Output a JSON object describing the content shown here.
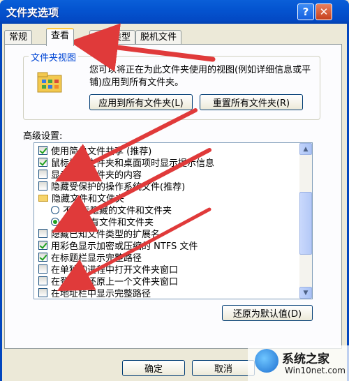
{
  "window": {
    "title": "文件夹选项",
    "help_label": "?",
    "close_label": "✕"
  },
  "tabs": [
    {
      "label": "常规"
    },
    {
      "label": "查看"
    },
    {
      "label": "文件类型"
    },
    {
      "label": "脱机文件"
    }
  ],
  "folder_view": {
    "title": "文件夹视图",
    "description": "您可以将正在为此文件夹使用的视图(例如详细信息或平铺)应用到所有文件夹。",
    "apply_all_label": "应用到所有文件夹(L)",
    "reset_all_label": "重置所有文件夹(R)"
  },
  "advanced": {
    "label": "高级设置:",
    "items": [
      {
        "type": "checkbox",
        "checked": true,
        "label": "使用简单文件共享 (推荐)"
      },
      {
        "type": "checkbox",
        "checked": true,
        "label": "鼠标指向文件夹和桌面项时显示提示信息"
      },
      {
        "type": "checkbox",
        "checked": false,
        "label": "显示系统文件夹的内容"
      },
      {
        "type": "checkbox",
        "checked": false,
        "label": "隐藏受保护的操作系统文件(推荐)"
      },
      {
        "type": "folder",
        "checked": false,
        "label": "隐藏文件和文件夹"
      },
      {
        "type": "radio",
        "checked": false,
        "label": "不显示隐藏的文件和文件夹"
      },
      {
        "type": "radio",
        "checked": true,
        "label": "显示所有文件和文件夹"
      },
      {
        "type": "checkbox",
        "checked": false,
        "label": "隐藏已知文件类型的扩展名"
      },
      {
        "type": "checkbox",
        "checked": true,
        "label": "用彩色显示加密或压缩的 NTFS 文件"
      },
      {
        "type": "checkbox",
        "checked": true,
        "label": "在标题栏显示完整路径"
      },
      {
        "type": "checkbox",
        "checked": false,
        "label": "在单独的进程中打开文件夹窗口"
      },
      {
        "type": "checkbox",
        "checked": false,
        "label": "在登录时还原上一个文件夹窗口"
      },
      {
        "type": "checkbox",
        "checked": false,
        "label": "在地址栏中显示完整路径"
      }
    ],
    "restore_defaults_label": "还原为默认值(D)"
  },
  "footer": {
    "ok_label": "确定",
    "cancel_label": "取消"
  },
  "watermark": {
    "title": "系统之家",
    "url": "Win10net.com"
  },
  "colors": {
    "titlebar": "#0454d0",
    "annotation_arrow": "#e03a3a",
    "check_green": "#21a121"
  }
}
